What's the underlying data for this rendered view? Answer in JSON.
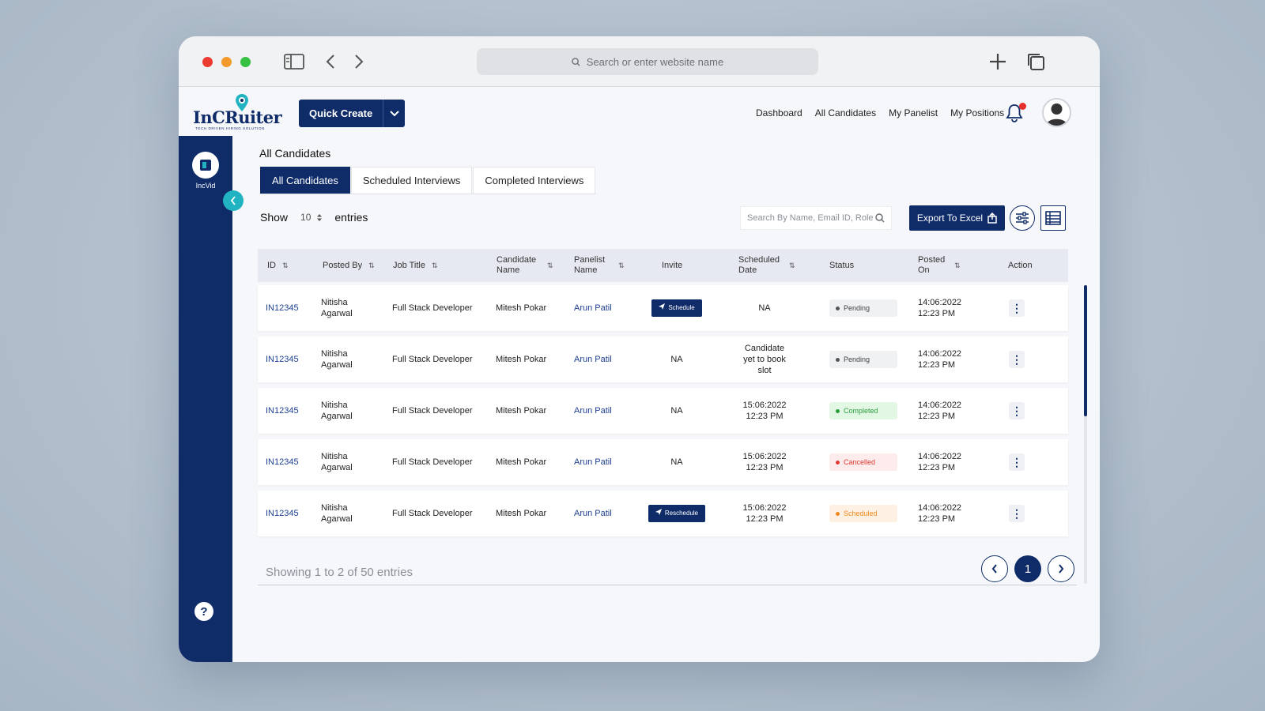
{
  "browser": {
    "url_placeholder": "Search or enter website name"
  },
  "brand": {
    "logo_text": "InCRuiter",
    "logo_tagline": "TECH DRIVEN HIRING SOLUTION"
  },
  "header": {
    "quick_create": "Quick Create",
    "nav": [
      "Dashboard",
      "All Candidates",
      "My Panelist",
      "My Positions"
    ]
  },
  "sidebar": {
    "incvid_label": "IncVid",
    "help": "?"
  },
  "page": {
    "title": "All Candidates",
    "tabs": [
      "All Candidates",
      "Scheduled Interviews",
      "Completed Interviews"
    ],
    "active_tab": "All Candidates",
    "show_label": "Show",
    "show_value": "10",
    "entries_label": "entries",
    "search_placeholder": "Search By Name, Email ID, Role",
    "export_label": "Export To Excel"
  },
  "table": {
    "headers": [
      "ID",
      "Posted By",
      "Job Title",
      "Candidate Name",
      "Panelist Name",
      "Invite",
      "Scheduled Date",
      "Status",
      "Posted On",
      "Action"
    ],
    "rows": [
      {
        "id": "IN12345",
        "posted_by": "Nitisha Agarwal",
        "job_title": "Full Stack Developer",
        "candidate": "Mitesh Pokar",
        "panelist": "Arun Patil",
        "invite": "Schedule",
        "invite_type": "button",
        "scheduled": "NA",
        "status": "Pending",
        "status_type": "pending",
        "posted_on": "14:06:2022 12:23 PM"
      },
      {
        "id": "IN12345",
        "posted_by": "Nitisha Agarwal",
        "job_title": "Full Stack Developer",
        "candidate": "Mitesh Pokar",
        "panelist": "Arun Patil",
        "invite": "NA",
        "invite_type": "text",
        "scheduled": "Candidate yet to book slot",
        "status": "Pending",
        "status_type": "pending",
        "posted_on": "14:06:2022 12:23 PM"
      },
      {
        "id": "IN12345",
        "posted_by": "Nitisha Agarwal",
        "job_title": "Full Stack Developer",
        "candidate": "Mitesh Pokar",
        "panelist": "Arun Patil",
        "invite": "NA",
        "invite_type": "text",
        "scheduled": "15:06:2022 12:23 PM",
        "status": "Completed",
        "status_type": "completed",
        "posted_on": "14:06:2022 12:23 PM"
      },
      {
        "id": "IN12345",
        "posted_by": "Nitisha Agarwal",
        "job_title": "Full Stack Developer",
        "candidate": "Mitesh Pokar",
        "panelist": "Arun Patil",
        "invite": "NA",
        "invite_type": "text",
        "scheduled": "15:06:2022 12:23 PM",
        "status": "Cancelled",
        "status_type": "cancelled",
        "posted_on": "14:06:2022 12:23 PM"
      },
      {
        "id": "IN12345",
        "posted_by": "Nitisha Agarwal",
        "job_title": "Full Stack Developer",
        "candidate": "Mitesh Pokar",
        "panelist": "Arun Patil",
        "invite": "Reschedule",
        "invite_type": "button",
        "scheduled": "15:06:2022 12:23 PM",
        "status": "Scheduled",
        "status_type": "scheduled",
        "posted_on": "14:06:2022 12:23 PM"
      }
    ]
  },
  "pagination": {
    "info": "Showing 1 to 2 of 50 entries",
    "current_page": "1"
  },
  "colors": {
    "primary": "#0f2c69",
    "accent": "#22b3c2",
    "pending": "#555555",
    "completed": "#2a9d3b",
    "cancelled": "#e03a32",
    "scheduled": "#f08a1c"
  }
}
